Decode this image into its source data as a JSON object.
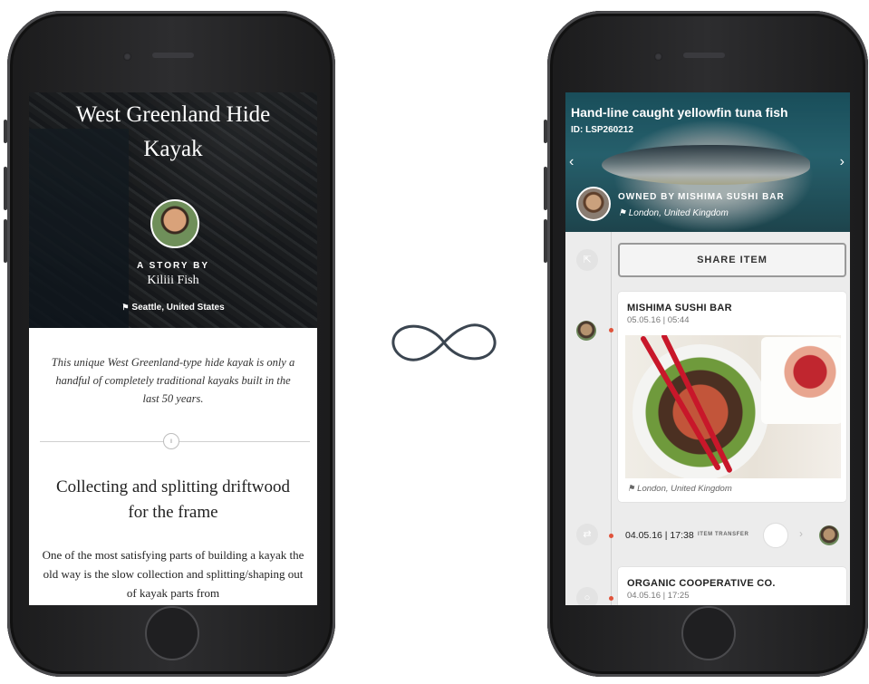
{
  "story": {
    "title": "West Greenland Hide Kayak",
    "byline_label": "A STORY BY",
    "author": "Kiliii Fish",
    "location": "Seattle, United States",
    "intro": "This unique West Greenland-type hide kayak is only a handful of completely traditional kayaks built in the last 50 years.",
    "section_title": "Collecting and splitting driftwood for the frame",
    "body": "One of the most satisfying parts of building a kayak the old way is the slow collection and splitting/shaping out of kayak parts from"
  },
  "item": {
    "title": "Hand-line caught yellowfin tuna fish",
    "id": "ID: LSP260212",
    "owner_label": "OWNED BY",
    "owner_name": "MISHIMA SUSHI BAR",
    "owner_location": "London, United Kingdom",
    "share_label": "SHARE ITEM",
    "events": [
      {
        "title": "MISHIMA SUSHI BAR",
        "time": "05.05.16 | 05:44",
        "location": "London, United Kingdom"
      },
      {
        "time": "04.05.16 | 17:38",
        "label": "ITEM TRANSFER"
      },
      {
        "title": "ORGANIC COOPERATIVE CO.",
        "time": "04.05.16 | 17:25"
      }
    ]
  },
  "icons": {
    "flag": "flag-icon",
    "infinity": "infinity-icon",
    "share": "share-icon",
    "transfer": "transfer-icon",
    "prev": "chevron-left-icon",
    "next": "chevron-right-icon"
  },
  "colors": {
    "accent": "#e0533b",
    "infinity_stroke": "#3b4550"
  }
}
